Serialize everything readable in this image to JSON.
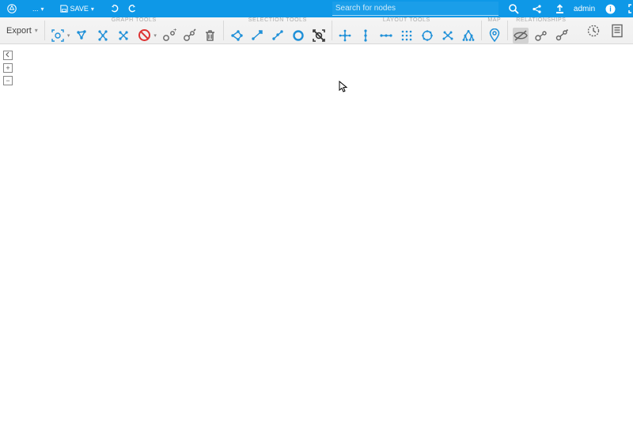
{
  "header": {
    "save_label": "SAVE",
    "search_placeholder": "Search for nodes",
    "user_label": "admin"
  },
  "ribbon": {
    "export_label": "Export",
    "groups": {
      "graph_tools": "GRAPH TOOLS",
      "selection_tools": "SELECTION TOOLS",
      "layout_tools": "LAYOUT TOOLS",
      "map": "MAP",
      "relationships": "RELATIONSHIPS"
    }
  }
}
